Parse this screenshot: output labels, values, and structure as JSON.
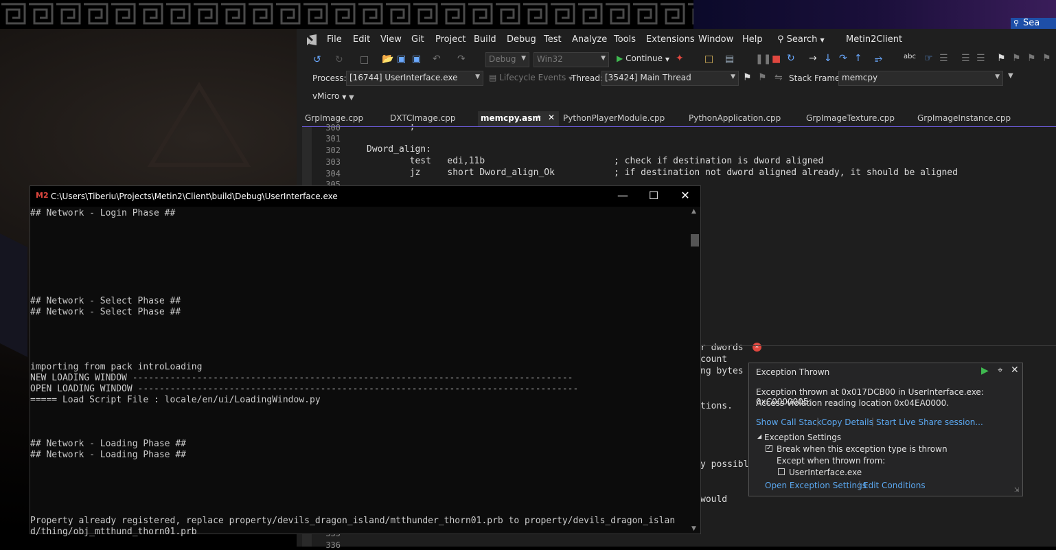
{
  "taskbar": {
    "search_label": "Sea"
  },
  "vs": {
    "menu": [
      "File",
      "Edit",
      "View",
      "Git",
      "Project",
      "Build",
      "Debug",
      "Test",
      "Analyze",
      "Tools",
      "Extensions",
      "Window",
      "Help"
    ],
    "search_label": "Search",
    "solution_name": "Metin2Client",
    "toolbar": {
      "config": "Debug",
      "platform": "Win32",
      "continue_label": "Continue"
    },
    "debug_bar": {
      "process_label": "Process:",
      "process_value": "[16744] UserInterface.exe",
      "lifecycle_label": "Lifecycle Events",
      "thread_label": "Thread:",
      "thread_value": "[35424] Main Thread",
      "stack_frame_label": "Stack Frame:",
      "stack_frame_value": "memcpy"
    },
    "vmicro_label": "vMicro",
    "tabs": [
      "GrpImage.cpp",
      "DXTCImage.cpp",
      "memcpy.asm",
      "PythonPlayerModule.cpp",
      "PythonApplication.cpp",
      "GrpImageTexture.cpp",
      "GrpImageInstance.cpp"
    ],
    "editor": {
      "lines": [
        {
          "num": "300",
          "code": "        ;"
        },
        {
          "num": "301",
          "code": ""
        },
        {
          "num": "302",
          "code": "Dword_align:"
        },
        {
          "num": "303",
          "code": "        test   edi,11b                        ; check if destination is dword aligned"
        },
        {
          "num": "304",
          "code": "        jz     short Dword_align_Ok           ; if destination not dword aligned already, it should be aligned"
        },
        {
          "num": "305",
          "code": ""
        }
      ],
      "fragments": [
        "r dwords",
        "count",
        "ng bytes",
        "tions.",
        "y possibl",
        "would"
      ],
      "bottom_lines": [
        "335",
        "336"
      ]
    }
  },
  "console": {
    "title": "C:\\Users\\Tiberiu\\Projects\\Metin2\\Client\\build\\Debug\\UserInterface.exe",
    "lines": [
      "## Network - Login Phase ##",
      "",
      "",
      "",
      "",
      "",
      "",
      "",
      "## Network - Select Phase ##",
      "## Network - Select Phase ##",
      "",
      "",
      "",
      "",
      "importing from pack introLoading",
      "NEW LOADING WINDOW ----------------------------------------------------------------------------------",
      "OPEN LOADING WINDOW ----------------------------------------------------------------------------------",
      "===== Load Script File : locale/en/ui/LoadingWindow.py",
      "",
      "",
      "",
      "## Network - Loading Phase ##",
      "## Network - Loading Phase ##",
      "",
      "",
      "",
      "",
      "",
      "Property already registered, replace property/devils_dragon_island/mtthunder_thorn01.prb to property/devils_dragon_islan",
      "d/thing/obj_mtthund_thorn01.prb"
    ]
  },
  "exception": {
    "title": "Exception Thrown",
    "message_line1": "Exception thrown at 0x017DCB00 in UserInterface.exe: 0xC0000005:",
    "message_line2": "Access violation reading location 0x04EA0000.",
    "show_call_stack": "Show Call Stack",
    "copy_details": "Copy Details",
    "live_share": "Start Live Share session...",
    "settings_header": "Exception Settings",
    "break_when": "Break when this exception type is thrown",
    "except_when": "Except when thrown from:",
    "module": "UserInterface.exe",
    "open_settings": "Open Exception Settings",
    "edit_conditions": "Edit Conditions"
  },
  "colors": {
    "accent": "#7160e8",
    "link": "#5ba8f0",
    "continue_green": "#3fb950",
    "stop_red": "#e0473f"
  }
}
